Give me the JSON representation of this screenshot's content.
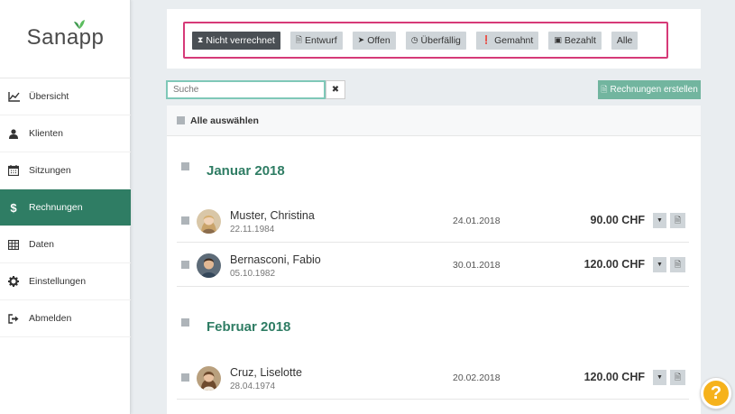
{
  "app": {
    "logo_text": "Sanapp",
    "accent_color": "#2f7d64",
    "highlight_color": "#d63a78"
  },
  "sidebar": {
    "items": [
      {
        "label": "Übersicht",
        "icon": "chart-line-icon",
        "active": false
      },
      {
        "label": "Klienten",
        "icon": "user-icon",
        "active": false
      },
      {
        "label": "Sitzungen",
        "icon": "calendar-icon",
        "active": false
      },
      {
        "label": "Rechnungen",
        "icon": "dollar-icon",
        "active": true
      },
      {
        "label": "Daten",
        "icon": "table-icon",
        "active": false
      },
      {
        "label": "Einstellungen",
        "icon": "gear-icon",
        "active": false
      },
      {
        "label": "Abmelden",
        "icon": "sign-out-icon",
        "active": false
      }
    ]
  },
  "filters": {
    "buttons": [
      {
        "label": "Nicht verrechnet",
        "icon": "hourglass-icon",
        "active": true
      },
      {
        "label": "Entwurf",
        "icon": "file-icon",
        "active": false
      },
      {
        "label": "Offen",
        "icon": "paper-plane-icon",
        "active": false
      },
      {
        "label": "Überfällig",
        "icon": "clock-icon",
        "active": false
      },
      {
        "label": "Gemahnt",
        "icon": "exclamation-icon",
        "active": false
      },
      {
        "label": "Bezahlt",
        "icon": "money-icon",
        "active": false
      },
      {
        "label": "Alle",
        "icon": "",
        "active": false
      }
    ]
  },
  "search": {
    "placeholder": "Suche",
    "value": ""
  },
  "create_button": {
    "label": "Rechnungen erstellen"
  },
  "list": {
    "select_all_label": "Alle auswählen",
    "groups": [
      {
        "month": "Januar 2018",
        "rows": [
          {
            "name": "Muster, Christina",
            "dob": "22.11.1984",
            "date": "24.01.2018",
            "amount": "90.00 CHF"
          },
          {
            "name": "Bernasconi, Fabio",
            "dob": "05.10.1982",
            "date": "30.01.2018",
            "amount": "120.00 CHF"
          }
        ]
      },
      {
        "month": "Februar 2018",
        "rows": [
          {
            "name": "Cruz, Liselotte",
            "dob": "28.04.1974",
            "date": "20.02.2018",
            "amount": "120.00 CHF"
          }
        ]
      }
    ]
  },
  "help": {
    "label": "?"
  }
}
